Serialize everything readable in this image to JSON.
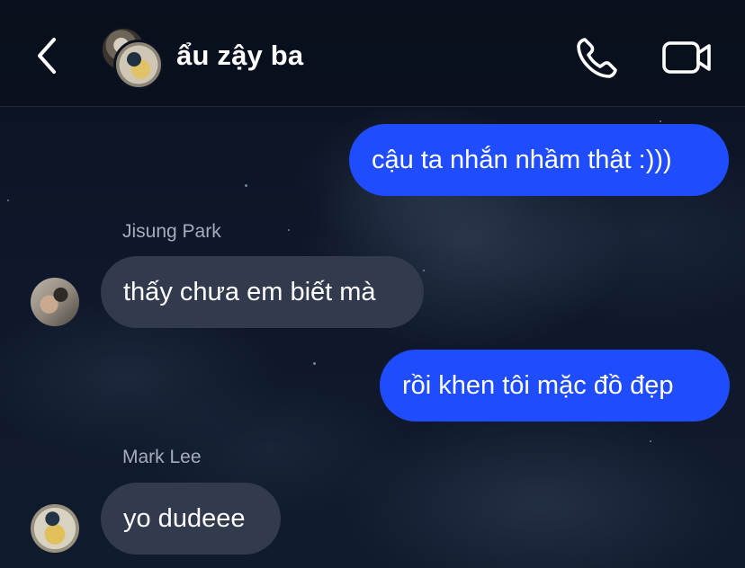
{
  "header": {
    "title": "ẩu zậy ba",
    "back_icon": "chevron-left-icon",
    "call_icon": "phone-icon",
    "video_icon": "video-camera-icon"
  },
  "messages": [
    {
      "direction": "outgoing",
      "text": "cậu ta nhắn nhầm thật :)))"
    },
    {
      "direction": "incoming",
      "sender": "Jisung Park",
      "text": "thấy chưa em biết mà"
    },
    {
      "direction": "outgoing",
      "text": "rồi khen tôi mặc đồ đẹp"
    },
    {
      "direction": "incoming",
      "sender": "Mark Lee",
      "text": "yo dudeee"
    }
  ],
  "colors": {
    "outgoing_bubble": "#1f4dfe",
    "incoming_bubble": "#323a4e",
    "sender_label": "#a5adbb",
    "background": "#0b1322"
  }
}
